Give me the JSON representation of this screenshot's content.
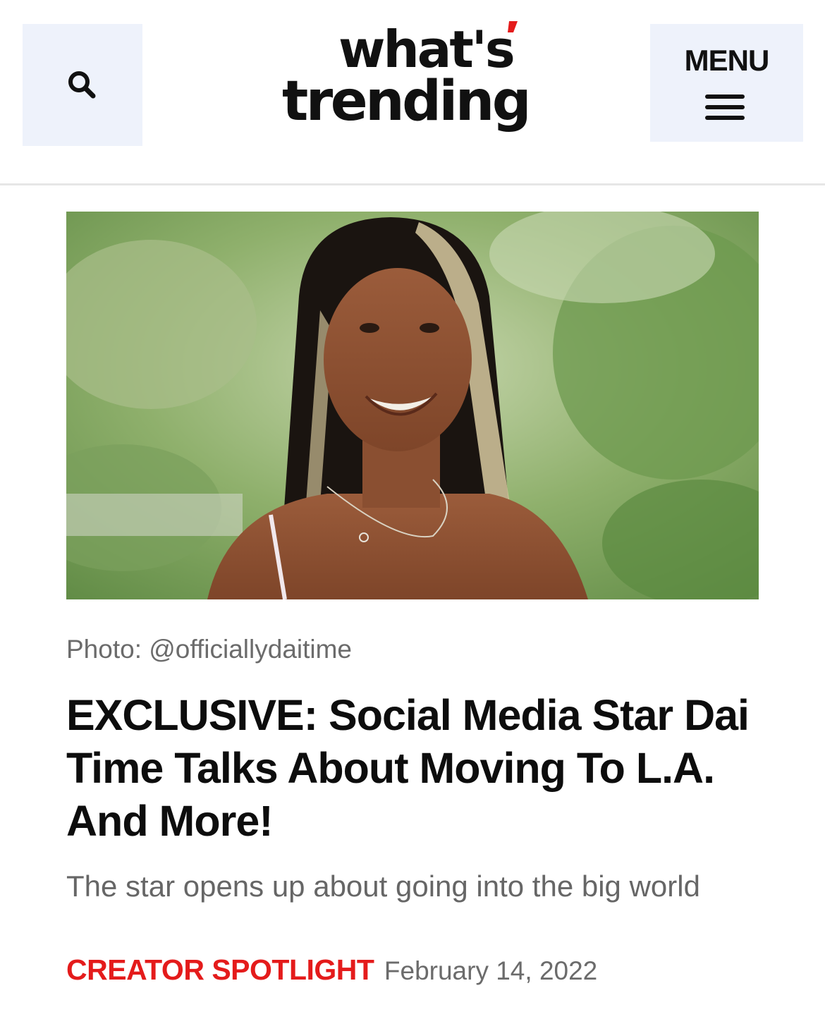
{
  "header": {
    "search_icon": "search-icon",
    "logo_line1": "what's",
    "logo_line2": "trending",
    "menu_label": "MENU",
    "menu_icon": "hamburger-icon"
  },
  "article": {
    "photo_credit": "Photo: @officiallydaitime",
    "headline": "EXCLUSIVE: Social Media Star Dai Time Talks About Moving To L.A. And More!",
    "subheadline": "The star opens up about going into the big world",
    "category": "CREATOR SPOTLIGHT",
    "date": "February 14, 2022"
  },
  "colors": {
    "accent_red": "#e41b1b",
    "button_bg": "#eef2fb",
    "text_dark": "#111111",
    "text_muted": "#6b6b6b"
  }
}
